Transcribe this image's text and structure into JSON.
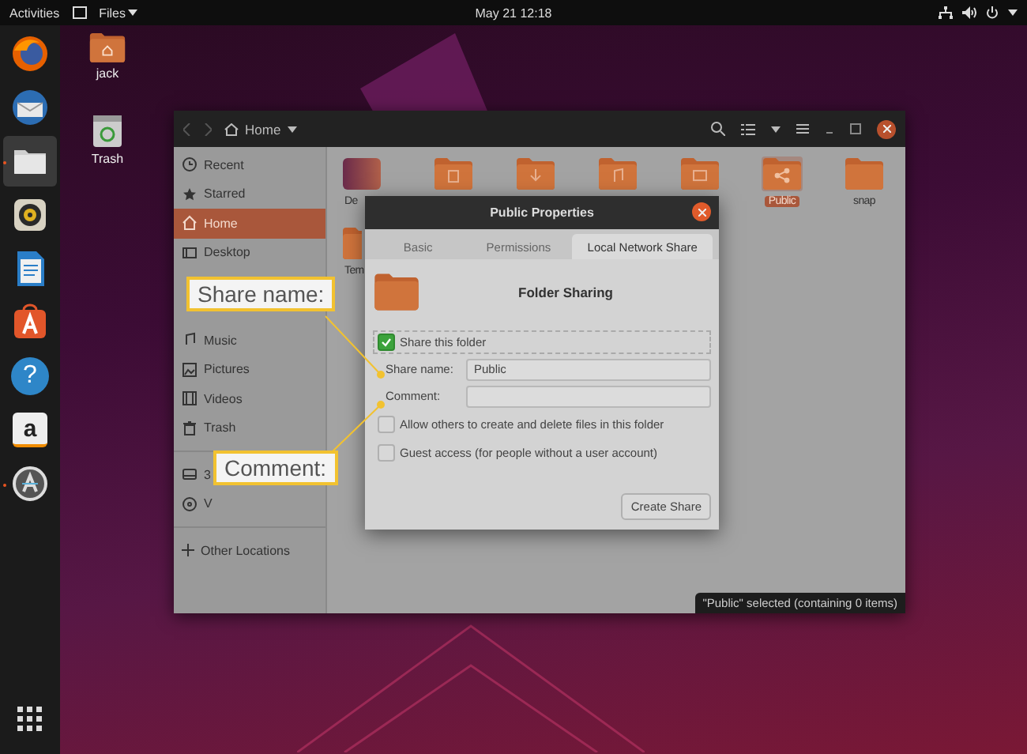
{
  "top_bar": {
    "activities": "Activities",
    "app_menu": "Files",
    "clock": "May 21  12:18"
  },
  "dock": [
    {
      "kind": "browser",
      "running": false
    },
    {
      "kind": "mail",
      "running": false
    },
    {
      "kind": "files",
      "running": true
    },
    {
      "kind": "music",
      "running": false
    },
    {
      "kind": "writer",
      "running": false
    },
    {
      "kind": "store",
      "running": false
    },
    {
      "kind": "help",
      "glyph": "?",
      "running": false
    },
    {
      "kind": "amazon",
      "glyph": "a",
      "running": false
    },
    {
      "kind": "updater",
      "running": true
    }
  ],
  "desktop_icons": [
    {
      "kind": "home",
      "label": "jack"
    },
    {
      "kind": "trash",
      "label": "Trash"
    }
  ],
  "files_window": {
    "location": "Home",
    "sidebar": [
      {
        "label": "Recent",
        "selected": false
      },
      {
        "label": "Starred",
        "selected": false
      },
      {
        "label": "Home",
        "selected": true
      },
      {
        "label": "Desktop",
        "selected": false
      },
      {
        "label": "Music",
        "selected": false
      },
      {
        "label": "Pictures",
        "selected": false
      },
      {
        "label": "Videos",
        "selected": false
      },
      {
        "label": "Trash",
        "selected": false
      }
    ],
    "devices": [
      {
        "label": "3"
      },
      {
        "label": "V"
      }
    ],
    "other_locations": "Other Locations",
    "folders": [
      {
        "kind": "desktop",
        "label": "De",
        "selected": false
      },
      {
        "kind": "documents",
        "selected": false
      },
      {
        "kind": "downloads",
        "selected": false
      },
      {
        "kind": "music",
        "selected": false
      },
      {
        "kind": "pictures",
        "selected": false
      },
      {
        "kind": "public",
        "label": "Public",
        "selected": true
      },
      {
        "kind": "plain",
        "label": "snap",
        "selected": false
      },
      {
        "kind": "templates",
        "label": "Tem",
        "selected": false
      }
    ],
    "status": "\"Public\" selected  (containing 0 items)"
  },
  "dialog": {
    "title": "Public Properties",
    "tabs": [
      {
        "label": "Basic",
        "selected": false
      },
      {
        "label": "Permissions",
        "selected": false
      },
      {
        "label": "Local Network Share",
        "selected": true
      }
    ],
    "heading": "Folder Sharing",
    "share_folder": {
      "label": "Share this folder",
      "checked": true
    },
    "share_name": {
      "label": "Share name:",
      "value": "Public"
    },
    "comment": {
      "label": "Comment:"
    },
    "options": [
      {
        "label": "Allow others to create and delete files in this folder",
        "checked": false
      },
      {
        "label": "Guest access (for people without a user account)",
        "checked": false
      }
    ],
    "button": "Create Share"
  },
  "callouts": [
    {
      "text": "Share name:"
    },
    {
      "text": "Comment:"
    }
  ]
}
